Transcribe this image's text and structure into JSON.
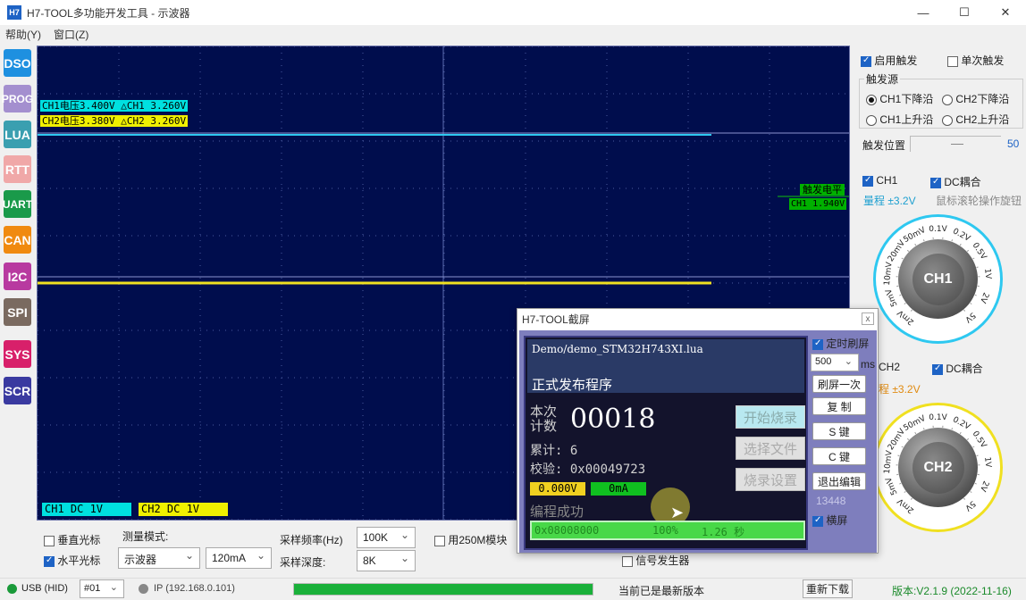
{
  "window": {
    "app_icon": "H7",
    "title": "H7-TOOL多功能开发工具 - 示波器",
    "minimize_icon": "—",
    "maximize_icon": "☐",
    "close_icon": "✕"
  },
  "menu": {
    "items": [
      "帮助(Y)",
      "窗口(Z)"
    ]
  },
  "sidebar": {
    "items": [
      {
        "label": "DSO",
        "color": "#1e90e0"
      },
      {
        "label": "PROG",
        "color": "#a48fcf"
      },
      {
        "label": "LUA",
        "color": "#3a9fb0"
      },
      {
        "label": "RTT",
        "color": "#f0a8a8"
      },
      {
        "label": "UART",
        "color": "#1a9a4a"
      },
      {
        "label": "CAN",
        "color": "#f08a10"
      },
      {
        "label": "I2C",
        "color": "#b83aa0"
      },
      {
        "label": "SPI",
        "color": "#7a6a60"
      },
      {
        "label": "SYS",
        "color": "#d8206a"
      },
      {
        "label": "SCR",
        "color": "#3a3aa0"
      }
    ]
  },
  "scope": {
    "ch1_label": "CH1电压3.400V  △CH1 3.260V",
    "ch2_label": "CH2电压3.380V  △CH2 3.260V",
    "trigger_label": "触发电平",
    "trigger_value": "CH1 1.940V",
    "ch1_badge": "CH1 DC     1V",
    "ch2_badge": "CH2 DC     1V",
    "colors": {
      "bg": "#000d4d",
      "ch1": "#2ec8f0",
      "ch2": "#f0e020",
      "trigger": "#10c010"
    }
  },
  "trigger": {
    "enable_label": "启用触发",
    "single_label": "单次触发",
    "source_title": "触发源",
    "sources": [
      "CH1下降沿",
      "CH2下降沿",
      "CH1上升沿",
      "CH2上升沿"
    ],
    "position_label": "触发位置",
    "position_value": "50"
  },
  "ch1": {
    "enable_label": "CH1",
    "dc_label": "DC耦合",
    "range_label": "量程 ±3.2V",
    "hint": "鼠标滚轮操作旋钮",
    "knob_label": "CH1",
    "knob_scale": [
      "2mV",
      "5mV",
      "10mV",
      "20mV",
      "50mV",
      "0.1V",
      "0.2V",
      "0.5V",
      "1V",
      "2V",
      "5V"
    ]
  },
  "ch2": {
    "enable_label": "CH2",
    "dc_label": "DC耦合",
    "range_label": "程 ±3.2V",
    "knob_label": "CH2",
    "knob_scale": [
      "2mV",
      "5mV",
      "10mV",
      "20mV",
      "50mV",
      "0.1V",
      "0.2V",
      "0.5V",
      "1V",
      "2V",
      "5V"
    ]
  },
  "bottom": {
    "vcursor_label": "垂直光标",
    "hcursor_label": "水平光标",
    "mode_label": "测量模式:",
    "mode_value": "示波器",
    "current_value": "120mA",
    "rate_label": "采样频率(Hz)",
    "rate_value": "100K",
    "depth_label": "采样深度:",
    "depth_value": "8K",
    "module_label": "用250M模块",
    "siggen_label": "信号发生器"
  },
  "status": {
    "usb": "USB (HID)",
    "device": "#01",
    "ip": "IP (192.168.0.101)",
    "progress": 1.0,
    "message": "当前已是最新版本",
    "download_label": "重新下载",
    "version": "版本:V2.1.9 (2022-11-16)"
  },
  "dialog": {
    "title": "H7-TOOL截屏",
    "close": "x",
    "file": "Demo/demo_STM32H743XI.lua",
    "subtitle": "正式发布程序",
    "count_label_1": "本次",
    "count_label_2": "计数",
    "count_value": "00018",
    "total_label": "累计: 6",
    "checksum_label": "校验: 0x00049723",
    "voltage": "0.000V",
    "current": "0mA",
    "result": "编程成功",
    "btn_start": "开始烧录",
    "btn_select": "选择文件",
    "btn_settings": "烧录设置",
    "progress_addr": "0x08008000",
    "progress_pct": "100%",
    "progress_time": "1.26 秒",
    "timed_refresh_label": "定时刷屏",
    "interval_value": "500",
    "interval_unit": "ms",
    "refresh_once": "刷屏一次",
    "copy": "复 制",
    "s_key": "S 键",
    "c_key": "C 键",
    "exit_edit": "退出编辑",
    "code": "13448",
    "landscape_label": "横屏"
  }
}
